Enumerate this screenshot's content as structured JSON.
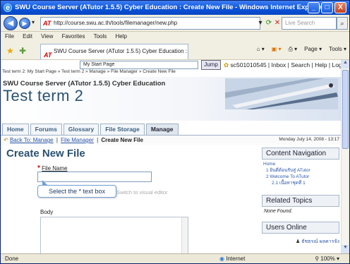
{
  "window": {
    "title": "SWU Course Server (ATutor 1.5.5) Cyber Education : Create New File - Windows Internet Explorer",
    "buttons": [
      "_",
      "□",
      "X"
    ]
  },
  "browser": {
    "url": "http://course.swu.ac.th/tools/filemanager/new.php",
    "search_placeholder": "Live Search",
    "menu": [
      "File",
      "Edit",
      "View",
      "Favorites",
      "Tools",
      "Help"
    ],
    "tab_title": "SWU Course Server (ATutor 1.5.5) Cyber Education :...",
    "tools": [
      "Page ▾",
      "Tools ▾"
    ],
    "status_left": "Done",
    "status_zone": "Internet",
    "status_zoom": "100%"
  },
  "page": {
    "jump_select": "My Start Page",
    "jump_button": "Jump",
    "user_links": "sc501010545 | Inbox | Search | Help | Log-out",
    "user_name": "sc501010545",
    "small_breadcrumb": "Test term 2: My Start Page » Test term 2 » Manage » File Manager » Create New File",
    "course_line": "SWU Course Server (ATutor 1.5.5) Cyber Education",
    "course_title": "Test term 2",
    "nav_tabs": [
      "Home",
      "Forums",
      "Glossary",
      "File Storage",
      "Manage"
    ],
    "subnav": {
      "back": "Back To: Manage",
      "filemanager": "File Manager",
      "current": "Create New File"
    },
    "date": "Monday July 14, 2008 - 13:17",
    "title": "Create New File",
    "form": {
      "filename_label": "File Name",
      "callout": "Select the * text box",
      "visual_editor": "Switch to visual editor",
      "body_label": "Body"
    },
    "sidebar": {
      "content_nav": "Content Navigation",
      "tree": [
        "Home",
        "1 ยินดีต้อนรับสู่ ATutor",
        "2 Welcome To ATutor",
        "2.1 เนื้อหาชุดที่ 1"
      ],
      "related": "Related Topics",
      "none_found": "None Found.",
      "users_online": "Users Online",
      "online_user": "ธัชธรณ์ ผลคารจัง"
    }
  }
}
